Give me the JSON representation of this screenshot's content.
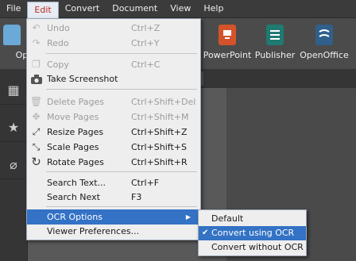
{
  "menubar": {
    "file": "File",
    "edit": "Edit",
    "convert": "Convert",
    "document": "Document",
    "view": "View",
    "help": "Help"
  },
  "toolbar": {
    "open_partial": "Ope",
    "powerpoint": "PowerPoint",
    "publisher": "Publisher",
    "openoffice": "OpenOffice",
    "colors": {
      "powerpoint": "#d5532b",
      "publisher": "#1f7a72",
      "openoffice": "#2f5f8a",
      "open": "#6aa9d8"
    }
  },
  "edit_menu": {
    "undo": {
      "label": "Undo",
      "shortcut": "Ctrl+Z",
      "icon": "undo-icon"
    },
    "redo": {
      "label": "Redo",
      "shortcut": "Ctrl+Y",
      "icon": "redo-icon"
    },
    "copy": {
      "label": "Copy",
      "shortcut": "Ctrl+C",
      "icon": "copy-icon"
    },
    "screenshot": {
      "label": "Take Screenshot",
      "icon": "camera-icon"
    },
    "delete_pages": {
      "label": "Delete Pages",
      "shortcut": "Ctrl+Shift+Del",
      "icon": "trash-icon"
    },
    "move_pages": {
      "label": "Move Pages",
      "shortcut": "Ctrl+Shift+M",
      "icon": "move-icon"
    },
    "resize_pages": {
      "label": "Resize Pages",
      "shortcut": "Ctrl+Shift+Z",
      "icon": "resize-icon"
    },
    "scale_pages": {
      "label": "Scale Pages",
      "shortcut": "Ctrl+Shift+S",
      "icon": "scale-icon"
    },
    "rotate_pages": {
      "label": "Rotate Pages",
      "shortcut": "Ctrl+Shift+R",
      "icon": "rotate-icon"
    },
    "search_text": {
      "label": "Search Text...",
      "shortcut": "Ctrl+F"
    },
    "search_next": {
      "label": "Search Next",
      "shortcut": "F3"
    },
    "ocr_options": {
      "label": "OCR Options"
    },
    "viewer_prefs": {
      "label": "Viewer Preferences..."
    }
  },
  "ocr_submenu": {
    "default": "Default",
    "convert_using_ocr": "Convert using OCR",
    "convert_without_ocr": "Convert without OCR",
    "selected": "Convert using OCR"
  }
}
